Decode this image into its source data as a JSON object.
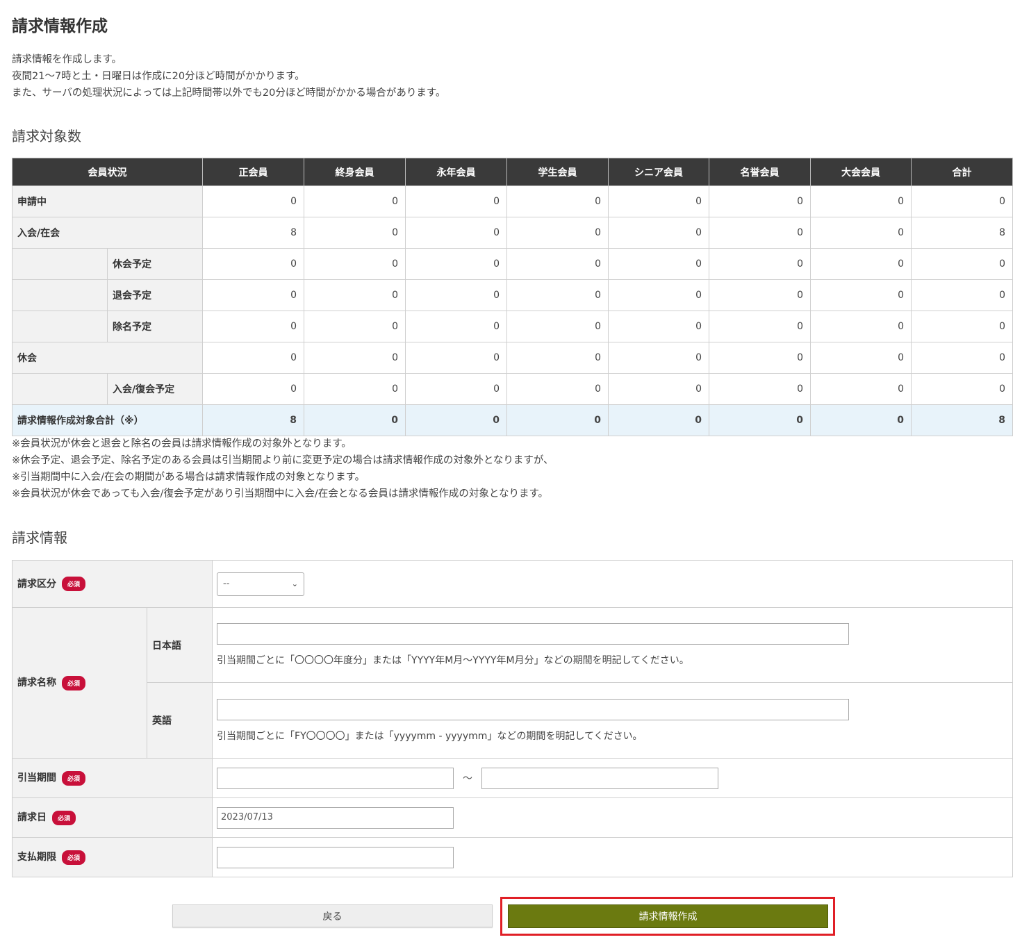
{
  "page": {
    "title": "請求情報作成",
    "intro": [
      "請求情報を作成します。",
      "夜間21～7時と土・日曜日は作成に20分ほど時間がかかります。",
      "また、サーバの処理状況によっては上記時間帯以外でも20分ほど時間がかかる場合があります。"
    ]
  },
  "count_section": {
    "heading": "請求対象数",
    "headers": [
      "会員状況",
      "正会員",
      "終身会員",
      "永年会員",
      "学生会員",
      "シニア会員",
      "名誉会員",
      "大会会員",
      "合計"
    ],
    "rows": [
      {
        "label": "申請中",
        "sub": false,
        "values": [
          "0",
          "0",
          "0",
          "0",
          "0",
          "0",
          "0",
          "0"
        ]
      },
      {
        "label": "入会/在会",
        "sub": false,
        "values": [
          "8",
          "0",
          "0",
          "0",
          "0",
          "0",
          "0",
          "8"
        ]
      },
      {
        "label": "休会予定",
        "sub": true,
        "values": [
          "0",
          "0",
          "0",
          "0",
          "0",
          "0",
          "0",
          "0"
        ]
      },
      {
        "label": "退会予定",
        "sub": true,
        "values": [
          "0",
          "0",
          "0",
          "0",
          "0",
          "0",
          "0",
          "0"
        ]
      },
      {
        "label": "除名予定",
        "sub": true,
        "values": [
          "0",
          "0",
          "0",
          "0",
          "0",
          "0",
          "0",
          "0"
        ]
      },
      {
        "label": "休会",
        "sub": false,
        "values": [
          "0",
          "0",
          "0",
          "0",
          "0",
          "0",
          "0",
          "0"
        ]
      },
      {
        "label": "入会/復会予定",
        "sub": true,
        "values": [
          "0",
          "0",
          "0",
          "0",
          "0",
          "0",
          "0",
          "0"
        ]
      }
    ],
    "total_row": {
      "label": "請求情報作成対象合計（※）",
      "values": [
        "8",
        "0",
        "0",
        "0",
        "0",
        "0",
        "0",
        "8"
      ]
    },
    "notes": [
      "※会員状況が休会と退会と除名の会員は請求情報作成の対象外となります。",
      "※休会予定、退会予定、除名予定のある会員は引当期間より前に変更予定の場合は請求情報作成の対象外となりますが、",
      "※引当期間中に入会/在会の期間がある場合は請求情報作成の対象となります。",
      "※会員状況が休会であっても入会/復会予定があり引当期間中に入会/在会となる会員は請求情報作成の対象となります。"
    ]
  },
  "form": {
    "heading": "請求情報",
    "required_badge": "必須",
    "billing_type": {
      "label": "請求区分",
      "selected": "--"
    },
    "billing_name": {
      "label": "請求名称",
      "japanese": {
        "label": "日本語",
        "value": "",
        "help": "引当期間ごとに「〇〇〇〇年度分」または「YYYY年M月～YYYY年M月分」などの期間を明記してください。"
      },
      "english": {
        "label": "英語",
        "value": "",
        "help": "引当期間ごとに「FY〇〇〇〇」または「yyyymm - yyyymm」などの期間を明記してください。"
      }
    },
    "period": {
      "label": "引当期間",
      "from": "",
      "separator": "～",
      "to": ""
    },
    "billing_date": {
      "label": "請求日",
      "value": "2023/07/13"
    },
    "due_date": {
      "label": "支払期限",
      "value": ""
    }
  },
  "buttons": {
    "back": "戻る",
    "create": "請求情報作成"
  },
  "colors": {
    "header_bg": "#3a3a3a",
    "required": "#c8103a",
    "create_button": "#6b7a10",
    "highlight": "#e01f26"
  }
}
